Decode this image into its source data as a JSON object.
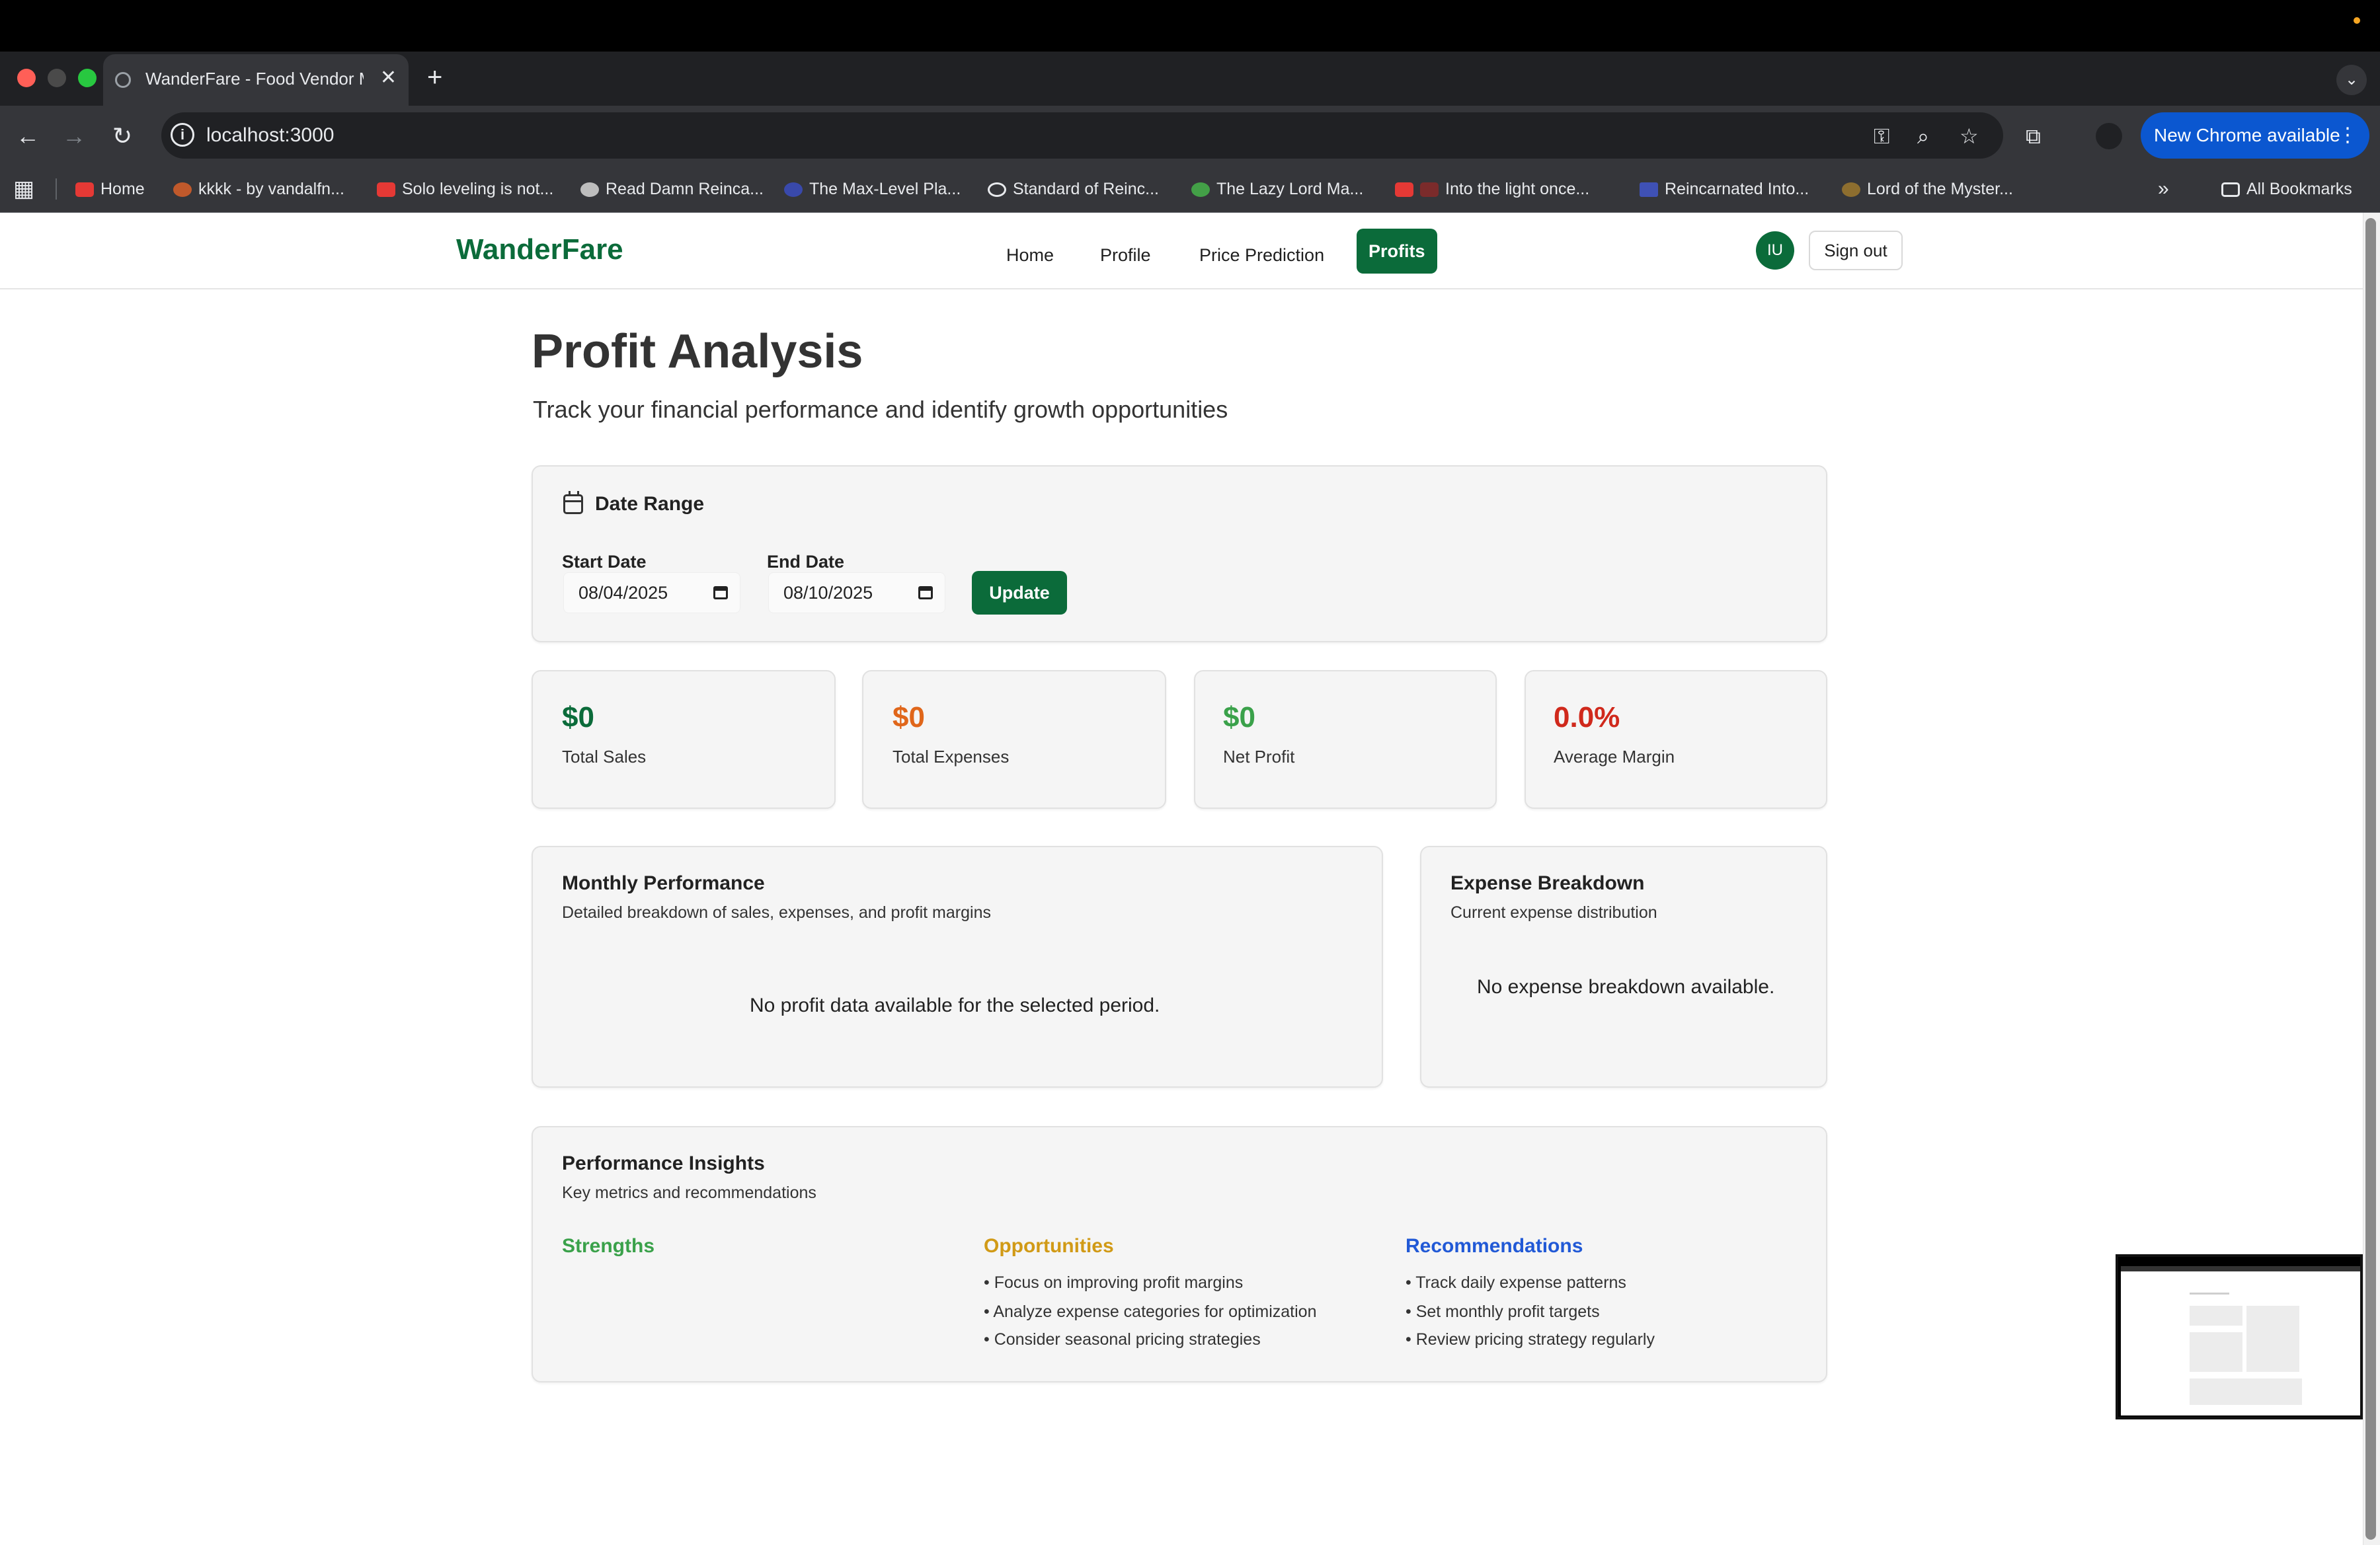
{
  "browser": {
    "tab_title": "WanderFare - Food Vendor M",
    "url": "localhost:3000",
    "update_label": "New Chrome available",
    "bookmarks": [
      "Home",
      "kkkk - by vandalfn...",
      "Solo leveling is not...",
      "Read Damn Reinca...",
      "The Max-Level Pla...",
      "Standard of Reinc...",
      "The Lazy Lord Ma...",
      "Into the light once...",
      "Reincarnated Into...",
      "Lord of the Myster..."
    ],
    "all_bookmarks": "All Bookmarks"
  },
  "header": {
    "brand": "WanderFare",
    "nav": [
      "Home",
      "Profile",
      "Price Prediction",
      "Profits"
    ],
    "active_nav": "Profits",
    "avatar_initials": "IU",
    "sign_out": "Sign out"
  },
  "page": {
    "title": "Profit Analysis",
    "subtitle": "Track your financial performance and identify growth opportunities"
  },
  "date_range": {
    "title": "Date Range",
    "start_label": "Start Date",
    "start_value": "08/04/2025",
    "end_label": "End Date",
    "end_value": "08/10/2025",
    "update_label": "Update"
  },
  "stats": [
    {
      "value": "$0",
      "label": "Total Sales",
      "color": "#0b6b3a"
    },
    {
      "value": "$0",
      "label": "Total Expenses",
      "color": "#e0661a"
    },
    {
      "value": "$0",
      "label": "Net Profit",
      "color": "#3aa14a"
    },
    {
      "value": "0.0%",
      "label": "Average Margin",
      "color": "#d0291c"
    }
  ],
  "monthly": {
    "title": "Monthly Performance",
    "subtitle": "Detailed breakdown of sales, expenses, and profit margins",
    "empty": "No profit data available for the selected period."
  },
  "expense": {
    "title": "Expense Breakdown",
    "subtitle": "Current expense distribution",
    "empty": "No expense breakdown available."
  },
  "insights": {
    "title": "Performance Insights",
    "subtitle": "Key metrics and recommendations",
    "strengths": {
      "title": "Strengths",
      "color": "#3aa14a",
      "items": []
    },
    "opportunities": {
      "title": "Opportunities",
      "color": "#d19a16",
      "items": [
        "• Focus on improving profit margins",
        "• Analyze expense categories for optimization",
        "• Consider seasonal pricing strategies"
      ]
    },
    "recommendations": {
      "title": "Recommendations",
      "color": "#2159d6",
      "items": [
        "• Track daily expense patterns",
        "• Set monthly profit targets",
        "• Review pricing strategy regularly"
      ]
    }
  }
}
